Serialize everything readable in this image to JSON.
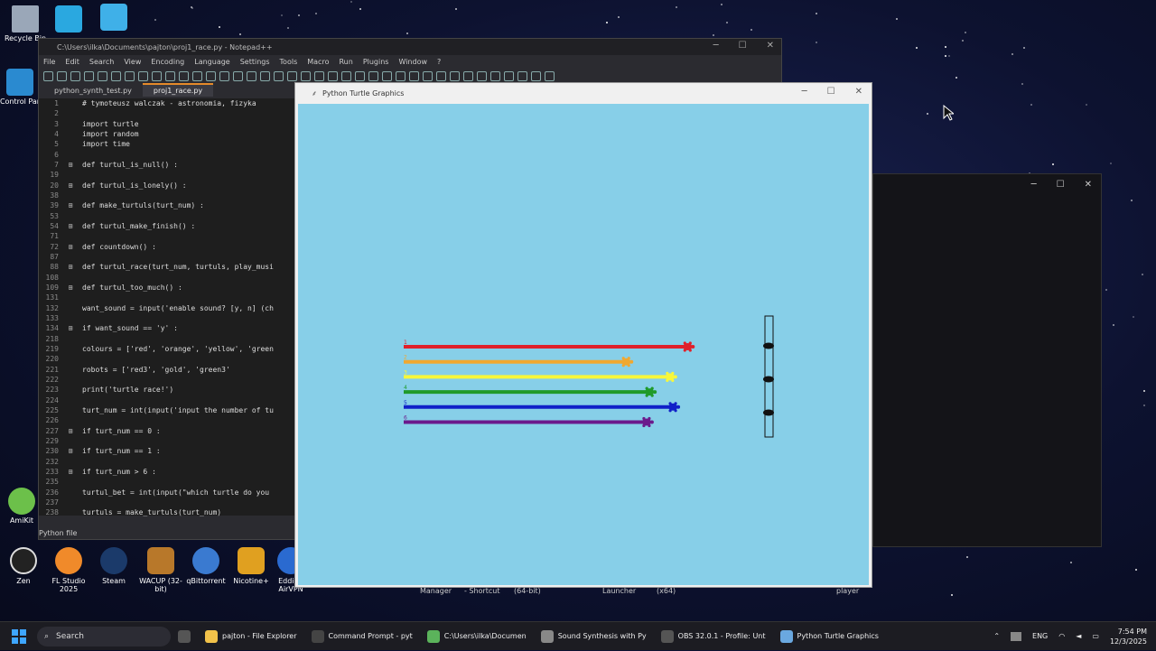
{
  "desktop": {
    "icons": [
      {
        "label": "Recycle Bin"
      },
      {
        "label": "Control Par"
      },
      {
        "label": "AmiKit"
      }
    ],
    "dock": [
      {
        "label": "Zen"
      },
      {
        "label": "FL Studio 2025"
      },
      {
        "label": "Steam"
      },
      {
        "label": "WACUP (32-bit)"
      },
      {
        "label": "qBittorrent"
      },
      {
        "label": "Nicotine+"
      },
      {
        "label": "Eddie - AirVPN"
      }
    ],
    "bg_labels": [
      "Manager",
      "- Shortcut",
      "(64-bit)",
      "Launcher",
      "(x64)",
      "player"
    ]
  },
  "notepad": {
    "title": "C:\\Users\\ilka\\Documents\\pajton\\proj1_race.py - Notepad++",
    "menu": [
      "File",
      "Edit",
      "Search",
      "View",
      "Encoding",
      "Language",
      "Settings",
      "Tools",
      "Macro",
      "Run",
      "Plugins",
      "Window",
      "?"
    ],
    "tabs": [
      "python_synth_test.py",
      "proj1_race.py"
    ],
    "status": "Python file",
    "lines": [
      {
        "n": "1",
        "f": "",
        "t": "# tymoteusz walczak - astronomia, fizyka",
        "c": "cm"
      },
      {
        "n": "2",
        "f": "",
        "t": "",
        "c": ""
      },
      {
        "n": "3",
        "f": "",
        "t": "import turtle",
        "c": "kw"
      },
      {
        "n": "4",
        "f": "",
        "t": "import random",
        "c": "kw"
      },
      {
        "n": "5",
        "f": "",
        "t": "import time",
        "c": "kw"
      },
      {
        "n": "6",
        "f": "",
        "t": "",
        "c": ""
      },
      {
        "n": "7",
        "f": "⊞",
        "t": "def turtul_is_null() :",
        "c": "fn"
      },
      {
        "n": "19",
        "f": "",
        "t": "",
        "c": ""
      },
      {
        "n": "20",
        "f": "⊞",
        "t": "def turtul_is_lonely() :",
        "c": "fn"
      },
      {
        "n": "38",
        "f": "",
        "t": "",
        "c": ""
      },
      {
        "n": "39",
        "f": "⊞",
        "t": "def make_turtuls(turt_num) :",
        "c": "fn"
      },
      {
        "n": "53",
        "f": "",
        "t": "",
        "c": ""
      },
      {
        "n": "54",
        "f": "⊞",
        "t": "def turtul_make_finish() :",
        "c": "fn"
      },
      {
        "n": "71",
        "f": "",
        "t": "",
        "c": ""
      },
      {
        "n": "72",
        "f": "⊞",
        "t": "def countdown() :",
        "c": "fn"
      },
      {
        "n": "87",
        "f": "",
        "t": "",
        "c": ""
      },
      {
        "n": "88",
        "f": "⊞",
        "t": "def turtul_race(turt_num, turtuls, play_musi",
        "c": "fn"
      },
      {
        "n": "108",
        "f": "",
        "t": "",
        "c": ""
      },
      {
        "n": "109",
        "f": "⊞",
        "t": "def turtul_too_much() :",
        "c": "fn"
      },
      {
        "n": "131",
        "f": "",
        "t": "",
        "c": ""
      },
      {
        "n": "132",
        "f": "",
        "t": "want_sound = input('enable sound? [y, n] (ch",
        "c": "str"
      },
      {
        "n": "133",
        "f": "",
        "t": "",
        "c": ""
      },
      {
        "n": "134",
        "f": "⊞",
        "t": "if want_sound == 'y' :",
        "c": "fn"
      },
      {
        "n": "218",
        "f": "",
        "t": "",
        "c": ""
      },
      {
        "n": "219",
        "f": "",
        "t": "colours = ['red', 'orange', 'yellow', 'green",
        "c": "str"
      },
      {
        "n": "220",
        "f": "",
        "t": "",
        "c": ""
      },
      {
        "n": "221",
        "f": "",
        "t": "robots = ['red3', 'gold', 'green3'",
        "c": "str"
      },
      {
        "n": "222",
        "f": "",
        "t": "",
        "c": ""
      },
      {
        "n": "223",
        "f": "",
        "t": "print('turtle race!')",
        "c": "str"
      },
      {
        "n": "224",
        "f": "",
        "t": "",
        "c": ""
      },
      {
        "n": "225",
        "f": "",
        "t": "turt_num = int(input('input the number of tu",
        "c": "str"
      },
      {
        "n": "226",
        "f": "",
        "t": "",
        "c": ""
      },
      {
        "n": "227",
        "f": "⊞",
        "t": "if turt_num == 0 :",
        "c": "fn"
      },
      {
        "n": "229",
        "f": "",
        "t": "",
        "c": ""
      },
      {
        "n": "230",
        "f": "⊞",
        "t": "if turt_num == 1 :",
        "c": "fn"
      },
      {
        "n": "232",
        "f": "",
        "t": "",
        "c": ""
      },
      {
        "n": "233",
        "f": "⊞",
        "t": "if turt_num > 6 :",
        "c": "fn"
      },
      {
        "n": "235",
        "f": "",
        "t": "",
        "c": ""
      },
      {
        "n": "236",
        "f": "",
        "t": "turtul_bet = int(input(\"which turtle do you",
        "c": "str"
      },
      {
        "n": "237",
        "f": "",
        "t": "",
        "c": ""
      },
      {
        "n": "238",
        "f": "",
        "t": "turtuls = make_turtuls(turt_num)",
        "c": "str"
      }
    ]
  },
  "turtle_window": {
    "title": "Python Turtle Graphics",
    "race": [
      {
        "label": "1",
        "color": "#e0202a",
        "progress": 0.97
      },
      {
        "label": "2",
        "color": "#f0a830",
        "progress": 0.76
      },
      {
        "label": "3",
        "color": "#f7f73a",
        "progress": 0.91
      },
      {
        "label": "4",
        "color": "#1f9a2a",
        "progress": 0.84
      },
      {
        "label": "5",
        "color": "#1020c8",
        "progress": 0.92
      },
      {
        "label": "6",
        "color": "#6b1a8c",
        "progress": 0.83
      }
    ]
  },
  "taskbar": {
    "search": "Search",
    "apps": [
      {
        "label": "pajton - File Explorer",
        "color": "#f2c24a"
      },
      {
        "label": "Command Prompt - pyt",
        "color": "#444"
      },
      {
        "label": "C:\\Users\\ilka\\Documen",
        "color": "#5bb35b"
      },
      {
        "label": "Sound Synthesis with Py",
        "color": "#888"
      },
      {
        "label": "OBS 32.0.1 - Profile: Unt",
        "color": "#555"
      },
      {
        "label": "Python Turtle Graphics",
        "color": "#6aa8e0"
      }
    ],
    "lang": "ENG",
    "time": "7:54 PM",
    "date": "12/3/2025"
  }
}
